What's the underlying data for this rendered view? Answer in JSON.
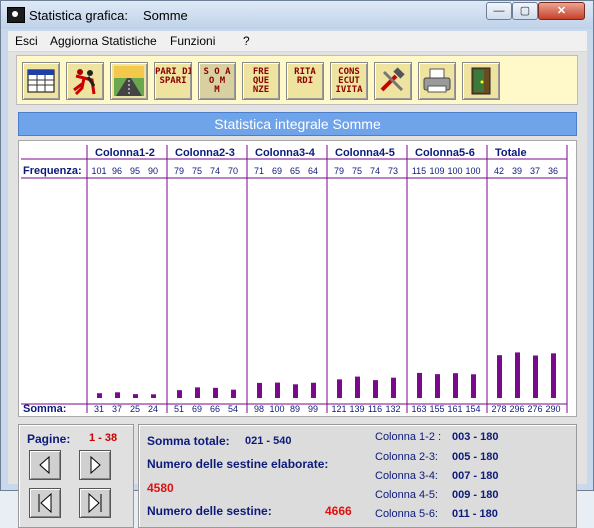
{
  "window": {
    "title": "Statistica grafica:",
    "subtitle": "Somme",
    "min": "—",
    "max": "▢",
    "close": "✕"
  },
  "menu": [
    {
      "label": "Esci"
    },
    {
      "label": "Aggiorna Statistiche"
    },
    {
      "label": "Funzioni"
    },
    {
      "label": "?"
    }
  ],
  "toolbar": [
    {
      "name": "table-icon",
      "text": ""
    },
    {
      "name": "dancers-icon",
      "text": ""
    },
    {
      "name": "road-icon",
      "text": ""
    },
    {
      "name": "pari-dispari-button",
      "text": "PARI DI\nSPARI"
    },
    {
      "name": "somme-button",
      "text": "S O A\nO M\nM"
    },
    {
      "name": "frequenze-button",
      "text": "FRE\nQUE\nNZE"
    },
    {
      "name": "ritardi-button",
      "text": "RITA\nRDI"
    },
    {
      "name": "consecutivita-button",
      "text": "CONS\nECUT\nIVITA"
    },
    {
      "name": "tools-icon",
      "text": ""
    },
    {
      "name": "printer-icon",
      "text": ""
    },
    {
      "name": "exit-door-icon",
      "text": ""
    }
  ],
  "banner": "Statistica integrale Somme",
  "chart_data": {
    "type": "bar",
    "freq_label": "Frequenza:",
    "somma_label": "Somma:",
    "groups": [
      {
        "name": "Colonna1-2",
        "frequenza": [
          101,
          96,
          95,
          90
        ],
        "somma": [
          31,
          37,
          25,
          24
        ]
      },
      {
        "name": "Colonna2-3",
        "frequenza": [
          79,
          75,
          74,
          70
        ],
        "somma": [
          51,
          69,
          66,
          54
        ]
      },
      {
        "name": "Colonna3-4",
        "frequenza": [
          71,
          69,
          65,
          64
        ],
        "somma": [
          98,
          100,
          89,
          99
        ]
      },
      {
        "name": "Colonna4-5",
        "frequenza": [
          79,
          75,
          74,
          73
        ],
        "somma": [
          121,
          139,
          116,
          132
        ]
      },
      {
        "name": "Colonna5-6",
        "frequenza": [
          115,
          109,
          100,
          100
        ],
        "somma": [
          163,
          155,
          161,
          154
        ]
      },
      {
        "name": "Totale",
        "frequenza": [
          42,
          39,
          37,
          36
        ],
        "somma": [
          278,
          296,
          276,
          290
        ]
      }
    ],
    "bar_color": "#7a0a8c"
  },
  "pages": {
    "label": "Pagine:",
    "value": "1 - 38"
  },
  "stats": {
    "somma_totale_label": "Somma totale:",
    "somma_totale_value": "021  -  540",
    "sestine_elaborate_label": "Numero delle sestine elaborate:",
    "sestine_elaborate_value": "4580",
    "sestine_label": "Numero delle sestine:",
    "sestine_value": "4666"
  },
  "colonne": [
    {
      "label": "Colonna 1-2 :",
      "value": "003  -  180"
    },
    {
      "label": "Colonna 2-3:",
      "value": "005  -  180"
    },
    {
      "label": "Colonna 3-4:",
      "value": "007  -  180"
    },
    {
      "label": "Colonna 4-5:",
      "value": "009  -  180"
    },
    {
      "label": "Colonna 5-6:",
      "value": "011  -  180"
    }
  ]
}
